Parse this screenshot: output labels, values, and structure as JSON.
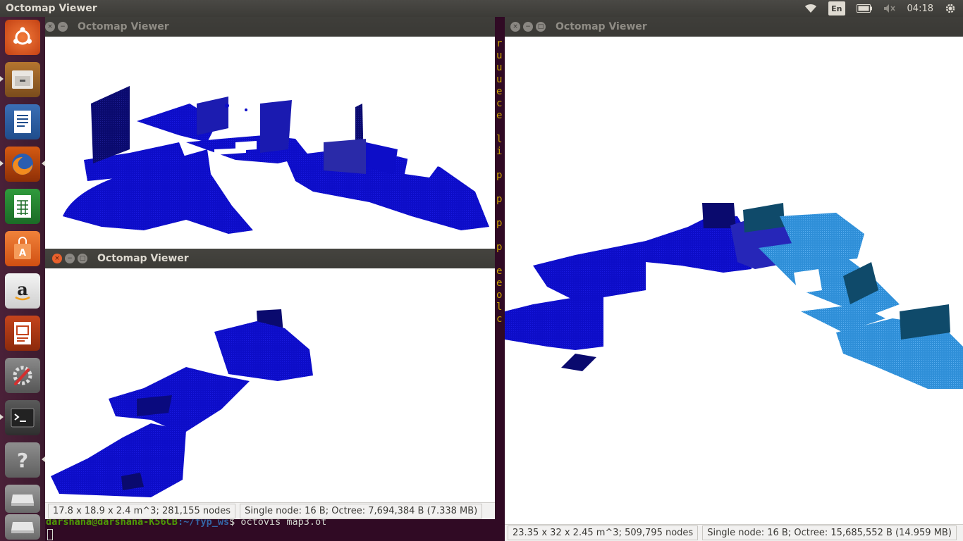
{
  "top_panel": {
    "title": "Octomap Viewer",
    "keyboard_layout": "En",
    "clock": "04:18"
  },
  "launcher": {
    "items": [
      "ubuntu-dash",
      "files",
      "libreoffice-writer",
      "firefox",
      "libreoffice-calc",
      "ubuntu-software-center",
      "amazon",
      "libreoffice-impress",
      "system-settings",
      "terminal",
      "help",
      "drive-1",
      "drive-2"
    ]
  },
  "terminal": {
    "prompt_user": "darshana@darshana-K56CB",
    "prompt_path": ":~/fyp_ws",
    "prompt_symbol": "$ ",
    "command": "octovis map3.ot",
    "partial_lines": [
      "r",
      "u",
      "u",
      "u",
      "e",
      "c",
      "e",
      "",
      "l",
      "i",
      "",
      "p",
      "",
      "p",
      "",
      "p",
      "",
      "p",
      "",
      "e",
      "e",
      "o",
      "l",
      "c"
    ]
  },
  "windows": {
    "top_left": {
      "title": "Octomap Viewer"
    },
    "bottom_left": {
      "title": "Octomap Viewer",
      "status_dims": "17.8 x 18.9 x 2.4 m^3; 281,155 nodes",
      "status_memory": "Single node: 16 B; Octree: 7,694,384 B (7.338 MB)"
    },
    "right": {
      "title": "Octomap Viewer",
      "status_dims": "23.35 x 32 x 2.45 m^3; 509,795 nodes",
      "status_memory": "Single node: 16 B; Octree: 15,685,552 B (14.959 MB)"
    }
  },
  "colors": {
    "voxel_dark_blue": "#0d0dc8",
    "voxel_navy": "#0a0a6e",
    "voxel_light_blue": "#2f8fd8",
    "voxel_teal": "#0f4a6a"
  }
}
